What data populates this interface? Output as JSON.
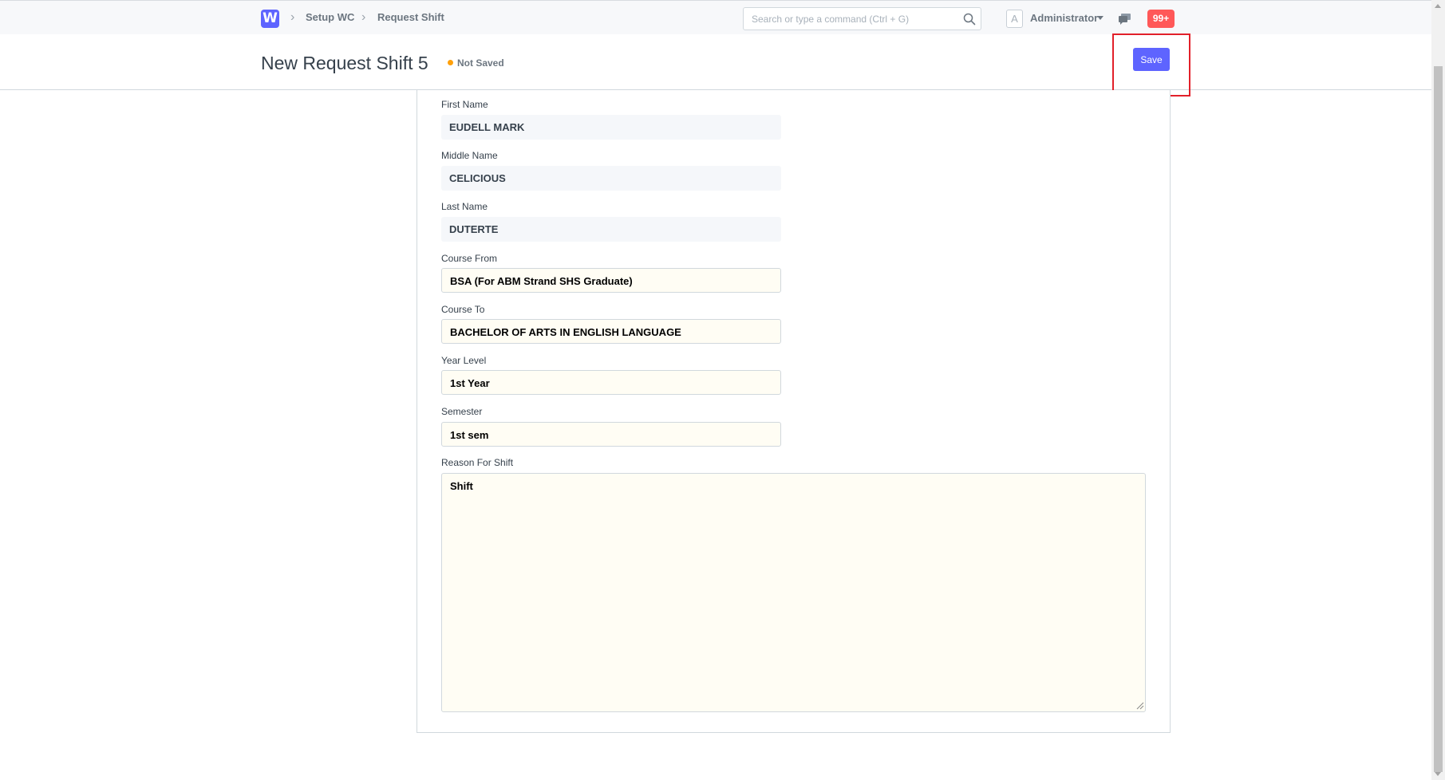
{
  "navbar": {
    "logo_letter": "W",
    "breadcrumbs": [
      "Setup WC",
      "Request Shift"
    ],
    "search_placeholder": "Search or type a command (Ctrl + G)",
    "avatar_letter": "A",
    "user_name": "Administrator",
    "notification_count": "99+"
  },
  "page": {
    "title": "New Request Shift 5",
    "status": "Not Saved",
    "save_label": "Save"
  },
  "form": {
    "fields": [
      {
        "label": "First Name",
        "value": "EUDELL MARK"
      },
      {
        "label": "Middle Name",
        "value": "CELICIOUS"
      },
      {
        "label": "Last Name",
        "value": "DUTERTE"
      },
      {
        "label": "Course From",
        "value": "BSA (For ABM Strand SHS Graduate)"
      },
      {
        "label": "Course To",
        "value": "BACHELOR OF ARTS IN ENGLISH LANGUAGE"
      },
      {
        "label": "Year Level",
        "value": "1st Year"
      },
      {
        "label": "Semester",
        "value": "1st sem"
      }
    ],
    "reason": {
      "label": "Reason For Shift",
      "value": "Shift"
    }
  },
  "colors": {
    "accent": "#5e64ff",
    "badge": "#ff5858",
    "status_dot": "#ffa00a",
    "highlight": "#e2202a"
  }
}
